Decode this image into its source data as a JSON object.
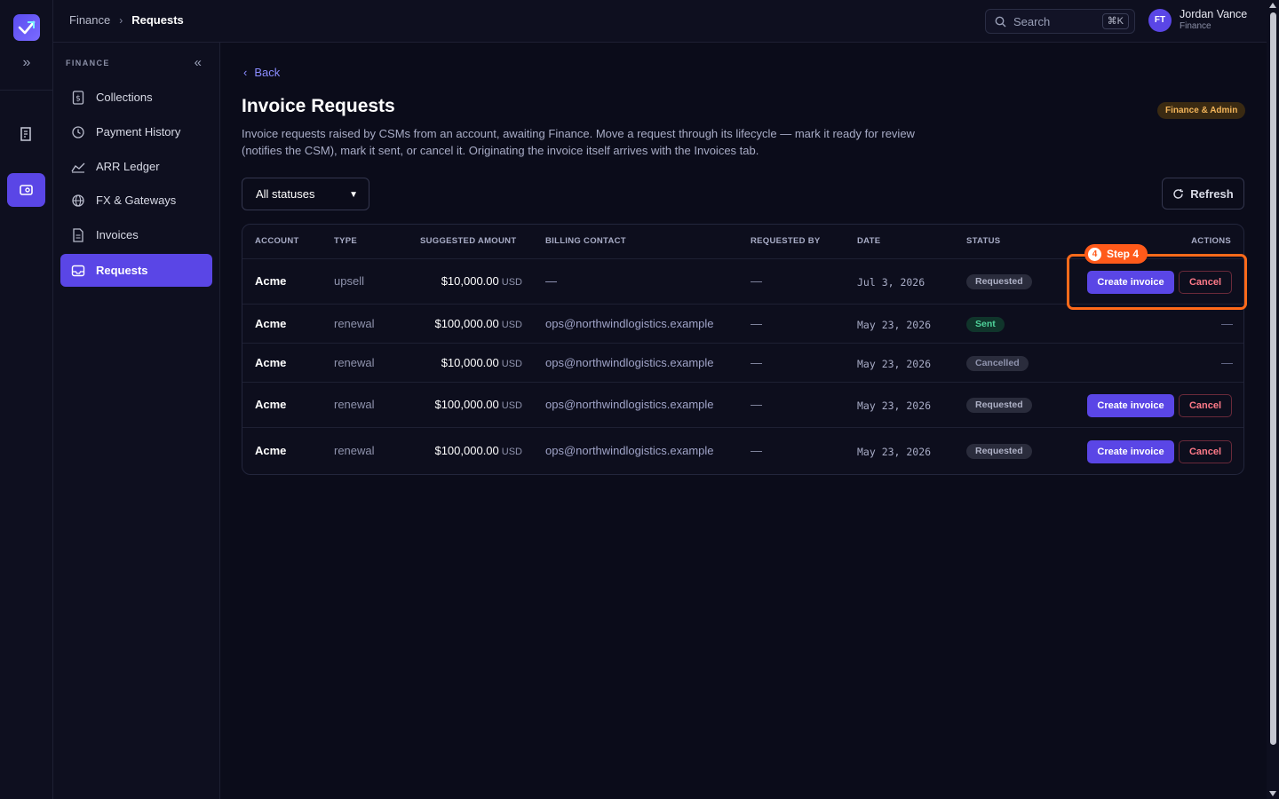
{
  "breadcrumb": {
    "parent": "Finance",
    "current": "Requests"
  },
  "search": {
    "placeholder": "Search",
    "shortcut": "⌘K"
  },
  "user": {
    "initials": "FT",
    "name": "Jordan Vance",
    "role": "Finance"
  },
  "sidebar": {
    "section": "FINANCE",
    "items": [
      {
        "label": "Collections"
      },
      {
        "label": "Payment History"
      },
      {
        "label": "ARR Ledger"
      },
      {
        "label": "FX & Gateways"
      },
      {
        "label": "Invoices"
      },
      {
        "label": "Requests"
      }
    ],
    "active": "Requests"
  },
  "main": {
    "back": "Back",
    "title": "Invoice Requests",
    "description": "Invoice requests raised by CSMs from an account, awaiting Finance. Move a request through its lifecycle — mark it ready for review (notifies the CSM), mark it sent, or cancel it. Originating the invoice itself arrives with the Invoices tab.",
    "role_badge": "Finance & Admin",
    "filter": {
      "selected": "All statuses"
    },
    "refresh": "Refresh"
  },
  "table": {
    "headers": [
      "ACCOUNT",
      "TYPE",
      "SUGGESTED AMOUNT",
      "BILLING CONTACT",
      "REQUESTED BY",
      "DATE",
      "STATUS",
      "ACTIONS"
    ],
    "rows": [
      {
        "account": "Acme",
        "type": "upsell",
        "amount": "$10,000.00",
        "currency": "USD",
        "contact": "—",
        "requested_by": "—",
        "date": "Jul 3, 2026",
        "status": "Requested",
        "actions": [
          "Create invoice",
          "Cancel"
        ]
      },
      {
        "account": "Acme",
        "type": "renewal",
        "amount": "$100,000.00",
        "currency": "USD",
        "contact": "ops@northwindlogistics.example",
        "requested_by": "—",
        "date": "May 23, 2026",
        "status": "Sent",
        "actions_text": "—"
      },
      {
        "account": "Acme",
        "type": "renewal",
        "amount": "$10,000.00",
        "currency": "USD",
        "contact": "ops@northwindlogistics.example",
        "requested_by": "—",
        "date": "May 23, 2026",
        "status": "Cancelled",
        "actions_text": "—"
      },
      {
        "account": "Acme",
        "type": "renewal",
        "amount": "$100,000.00",
        "currency": "USD",
        "contact": "ops@northwindlogistics.example",
        "requested_by": "—",
        "date": "May 23, 2026",
        "status": "Requested",
        "actions": [
          "Create invoice",
          "Cancel"
        ]
      },
      {
        "account": "Acme",
        "type": "renewal",
        "amount": "$100,000.00",
        "currency": "USD",
        "contact": "ops@northwindlogistics.example",
        "requested_by": "—",
        "date": "May 23, 2026",
        "status": "Requested",
        "actions": [
          "Create invoice",
          "Cancel"
        ]
      }
    ]
  },
  "step": {
    "number": "4",
    "label": "Step 4"
  },
  "colors": {
    "accent": "#5a46e6",
    "step": "#ff5a1a",
    "badge": "#f3b55a"
  },
  "icons": [
    "logo-icon",
    "expand-icon",
    "building-icon",
    "requests-icon",
    "collapse-icon",
    "dollar-doc-icon",
    "history-icon",
    "chart-icon",
    "globe-icon",
    "document-icon",
    "inbox-icon",
    "search-icon",
    "chevron-left-icon",
    "refresh-icon",
    "select-chevron-icon"
  ]
}
